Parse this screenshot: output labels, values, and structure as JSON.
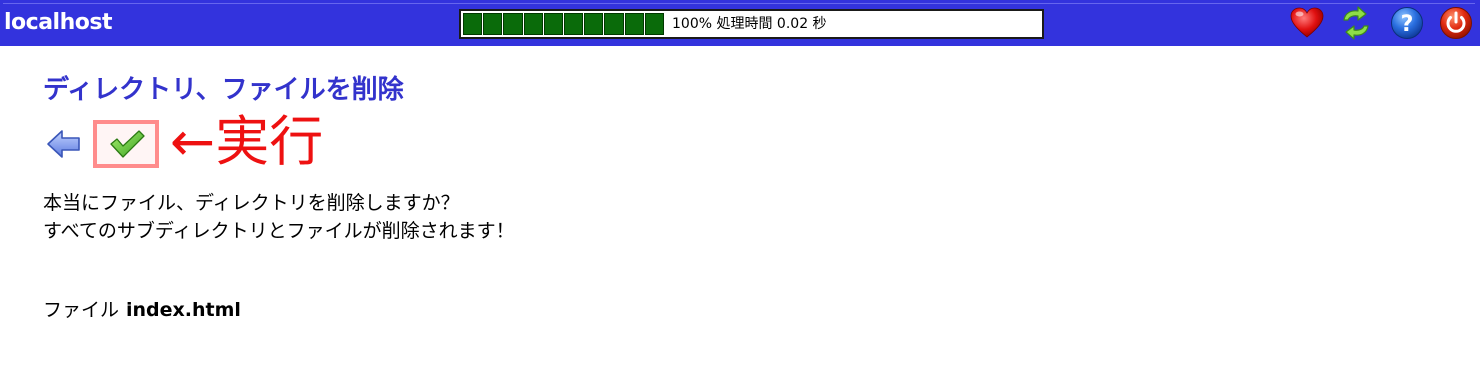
{
  "header": {
    "title": "localhost",
    "progress": {
      "percent": 100,
      "segments": 10,
      "label": "100% 処理時間 0.02 秒"
    },
    "icons": [
      "heart-icon",
      "refresh-icon",
      "help-icon",
      "power-icon"
    ]
  },
  "main": {
    "title": "ディレクトリ、ファイルを削除",
    "back_icon": "back-arrow-icon",
    "execute_icon": "checkmark-icon",
    "annotation": "←実行",
    "message_line1": "本当にファイル、ディレクトリを削除しますか？",
    "message_line2": "すべてのサブディレクトリとファイルが削除されます！",
    "file_label": "ファイル",
    "file_name": "index.html"
  },
  "colors": {
    "header_bg": "#3333dd",
    "title": "#3333cc",
    "progress_fill": "#0a6b0a",
    "annotation": "#ee1111",
    "highlight_border": "#ff8c8c"
  }
}
